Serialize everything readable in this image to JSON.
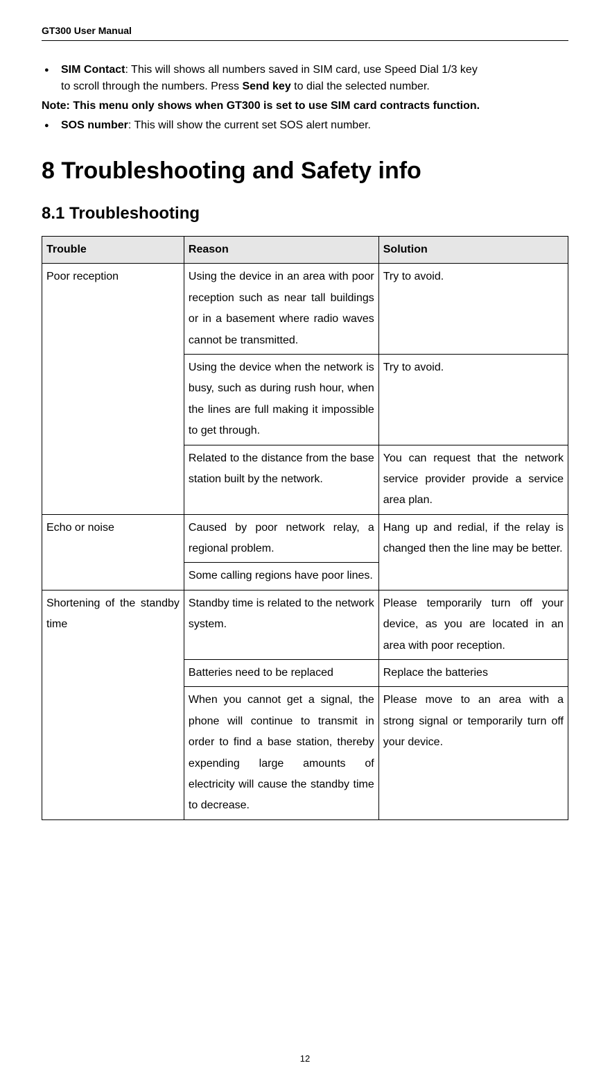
{
  "header": "GT300 User Manual",
  "bullets": {
    "b1_label": "SIM Contact",
    "b1_rest": ": This will shows all numbers saved in SIM card, use Speed Dial 1/3 key",
    "b1_line2_pre": "to scroll through the numbers. Press ",
    "b1_line2_bold": "Send key",
    "b1_line2_post": " to dial the selected number.",
    "note": "Note: This menu only shows when GT300 is set to use SIM card contracts function.",
    "b2_label": "SOS number",
    "b2_rest": ": This will show the current set SOS alert number."
  },
  "h1": "8 Troubleshooting and Safety info",
  "h2": "8.1 Troubleshooting",
  "table": {
    "head": {
      "c1": "Trouble",
      "c2": "Reason",
      "c3": "Solution"
    },
    "rows": [
      {
        "trouble": "Poor reception",
        "reason": "Using the device in an area with poor reception such as near tall buildings or in a basement where radio waves cannot be transmitted.",
        "solution": "Try to avoid."
      },
      {
        "reason": "Using the device when the network is busy, such as during rush hour, when the lines are full making it impossible to get through.",
        "solution": "Try to avoid."
      },
      {
        "reason": "Related to the distance from the base station built by the network.",
        "solution": "You can request that the network service provider provide a service area plan."
      },
      {
        "trouble": "Echo or noise",
        "reason": "Caused by poor network relay, a regional problem.",
        "solution": "Hang up and redial, if the relay is changed then the line may be better."
      },
      {
        "reason": "Some calling regions have poor lines."
      },
      {
        "trouble": "Shortening of the standby time",
        "reason": "Standby time is related to the network system.",
        "solution": "Please temporarily turn off your device, as you are located in an area with poor reception."
      },
      {
        "reason": "Batteries need to be replaced",
        "solution": "Replace the batteries"
      },
      {
        "reason": "When you cannot get a signal, the phone will continue to transmit in order to find a base station, thereby expending large amounts of electricity will cause the standby time to decrease.",
        "solution": "Please move to an area with a strong signal or temporarily turn off your device."
      }
    ]
  },
  "page_number": "12"
}
